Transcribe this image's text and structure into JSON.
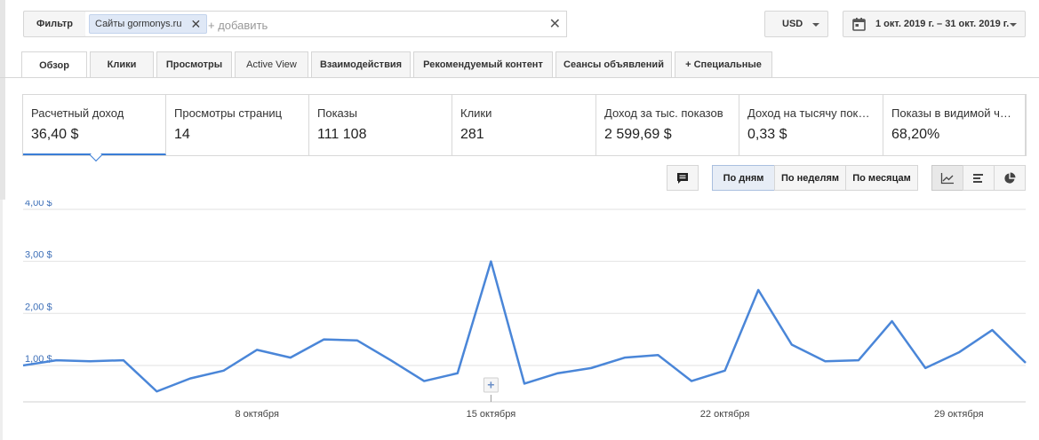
{
  "filter": {
    "label": "Фильтр",
    "chip": "Сайты gormonys.ru",
    "placeholder": "+ добавить"
  },
  "currency": {
    "value": "USD"
  },
  "date_range": {
    "value": "1 окт. 2019 г. – 31 окт. 2019 г."
  },
  "tabs": [
    {
      "label": "Обзор",
      "active": true
    },
    {
      "label": "Клики"
    },
    {
      "label": "Просмотры"
    },
    {
      "label": "Active View"
    },
    {
      "label": "Взаимодействия"
    },
    {
      "label": "Рекомендуемый контент"
    },
    {
      "label": "Сеансы объявлений"
    },
    {
      "label": "+  Специальные"
    }
  ],
  "metrics": [
    {
      "label": "Расчетный доход",
      "value": "36,40 $",
      "selected": true
    },
    {
      "label": "Просмотры страниц",
      "value": "14"
    },
    {
      "label": "Показы",
      "value": "111 108"
    },
    {
      "label": "Клики",
      "value": "281"
    },
    {
      "label": "Доход за тыс. показов",
      "value": "2 599,69 $"
    },
    {
      "label": "Доход на тысячу показов",
      "value": "0,33 $"
    },
    {
      "label": "Показы в видимой части",
      "value": "68,20%"
    }
  ],
  "granularity": {
    "options": [
      "По дням",
      "По неделям",
      "По месяцам"
    ],
    "selected": "По дням"
  },
  "icons": {
    "comment": "comment-icon",
    "line_chart": "line-chart-icon",
    "bar_chart": "bar-chart-icon",
    "pie_chart": "pie-chart-icon",
    "calendar": "calendar-icon"
  },
  "colors": {
    "line": "#4a86d8",
    "axis_label": "#3d6fb8",
    "accent": "#3a7dd6"
  },
  "chart_data": {
    "type": "line",
    "x": [
      1,
      2,
      3,
      4,
      5,
      6,
      7,
      8,
      9,
      10,
      11,
      12,
      13,
      14,
      15,
      16,
      17,
      18,
      19,
      20,
      21,
      22,
      23,
      24,
      25,
      26,
      27,
      28,
      29,
      30,
      31
    ],
    "x_tick_labels": [
      {
        "day": 8,
        "label": "8 октября"
      },
      {
        "day": 15,
        "label": "15 октября"
      },
      {
        "day": 22,
        "label": "22 октября"
      },
      {
        "day": 29,
        "label": "29 октября"
      }
    ],
    "series": [
      {
        "values": [
          1.0,
          1.1,
          1.08,
          1.1,
          0.5,
          0.75,
          0.9,
          1.3,
          1.15,
          1.5,
          1.48,
          1.1,
          0.7,
          0.85,
          3.0,
          0.65,
          0.85,
          0.95,
          1.15,
          1.2,
          0.7,
          0.9,
          2.45,
          1.4,
          1.08,
          1.1,
          1.85,
          0.95,
          1.25,
          1.68,
          1.05
        ]
      }
    ],
    "y_ticks": [
      "1,00 $",
      "2,00 $",
      "3,00 $",
      "4,00 $"
    ],
    "ylim": [
      0.3,
      4.0
    ],
    "grid": true
  }
}
